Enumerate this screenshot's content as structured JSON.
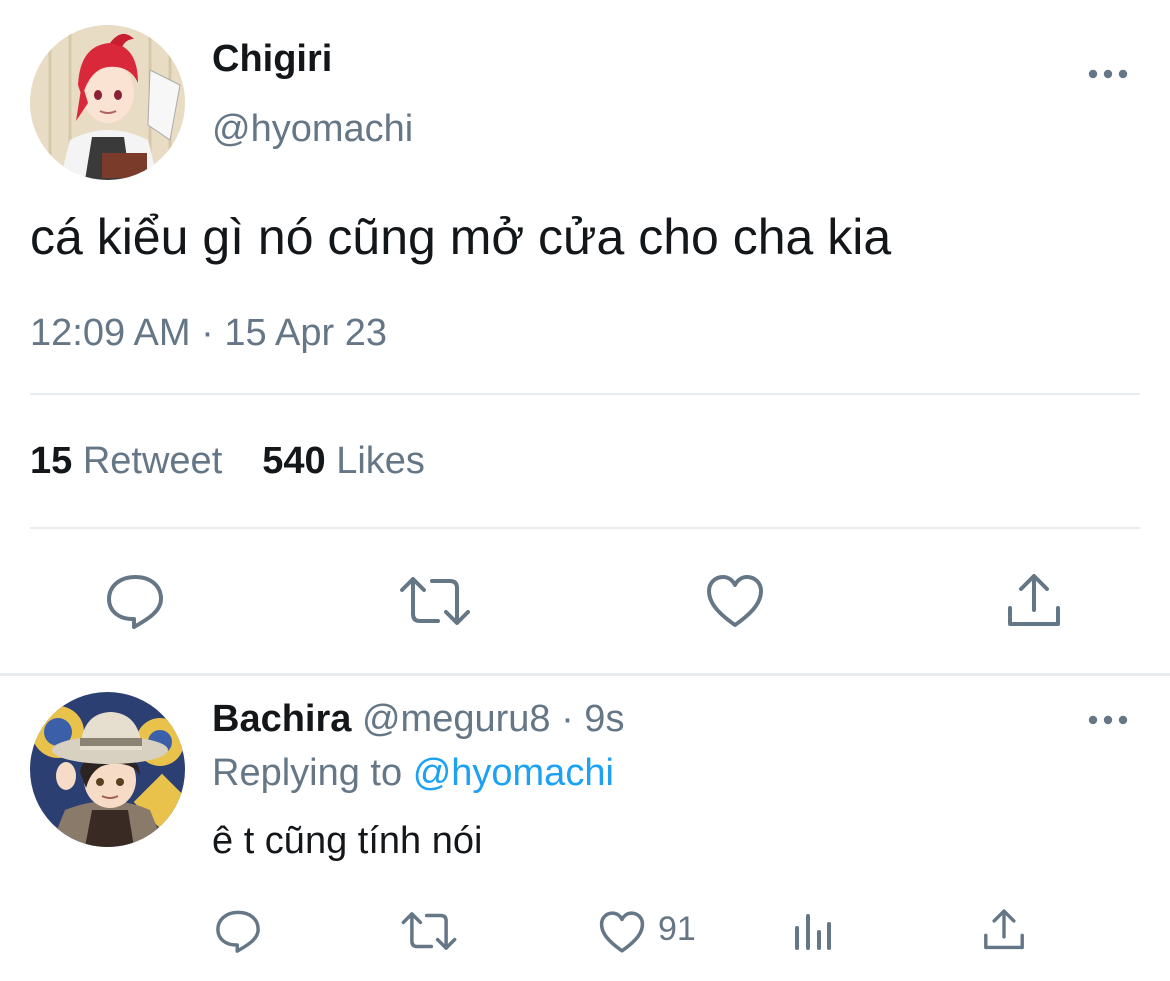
{
  "main_tweet": {
    "name": "Chigiri",
    "handle": "@hyomachi",
    "text": "cá kiểu gì nó cũng mở cửa cho cha kia",
    "timestamp": "12:09 AM · 15 Apr 23",
    "retweet_count": "15",
    "retweet_label": "Retweet",
    "like_count": "540",
    "like_label": "Likes",
    "avatar_icon": "anime-avatar-red-hair",
    "actions": [
      "reply-icon",
      "retweet-icon",
      "like-icon",
      "share-icon"
    ]
  },
  "reply": {
    "name": "Bachira",
    "handle": "@meguru8",
    "time": "· 9s",
    "replying_prefix": "Replying to",
    "replying_handle": "@hyomachi",
    "text": "ê t cũng tính nói",
    "like_count": "91",
    "avatar_icon": "anime-avatar-hat",
    "actions": [
      "reply-icon",
      "retweet-icon",
      "like-icon",
      "analytics-icon",
      "share-icon"
    ]
  },
  "colors": {
    "text": "#14171a",
    "secondary": "#657786",
    "link": "#1da1f2",
    "divider": "#e6ecf0"
  }
}
